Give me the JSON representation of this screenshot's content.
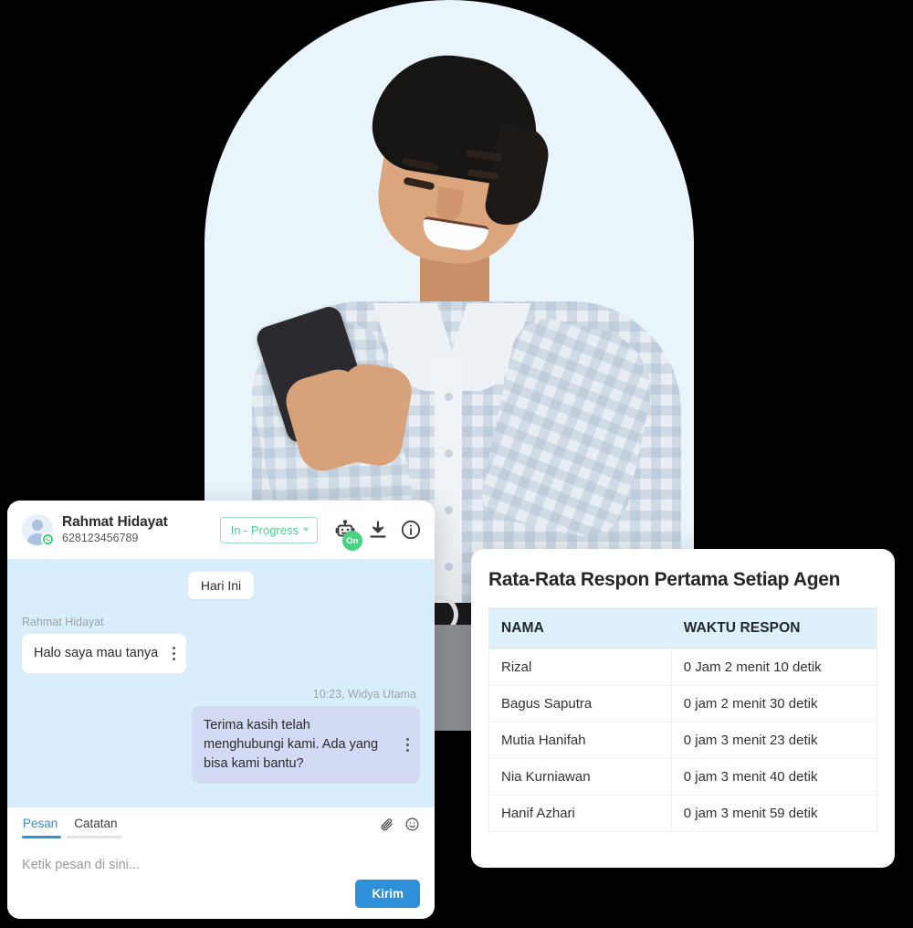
{
  "hero": {
    "alt": "smiling-young-man-using-smartphone",
    "arch_background_color": "#e9f4fb"
  },
  "chat": {
    "header": {
      "contact_name": "Rahmat Hidayat",
      "contact_phone": "628123456789",
      "status_label": "In - Progress",
      "bot_badge_label": "On",
      "icons": [
        "robot-icon",
        "download-icon",
        "info-icon"
      ],
      "accent_color": "#4fcf92"
    },
    "date_divider": "Hari Ini",
    "messages": [
      {
        "direction": "in",
        "meta": "Rahmat Hidayat",
        "text": "Halo saya mau tanya"
      },
      {
        "direction": "out",
        "meta": "10:23, Widya Utama",
        "text": "Terima kasih telah menghubungi kami. Ada yang bisa kami bantu?"
      }
    ],
    "composer": {
      "tabs": [
        {
          "label": "Pesan",
          "active": true
        },
        {
          "label": "Catatan",
          "active": false
        }
      ],
      "placeholder": "Ketik pesan di sini...",
      "send_label": "Kirim",
      "attach_icon": "paperclip-icon",
      "emoji_icon": "smiley-icon",
      "accent_color": "#2e90d8"
    }
  },
  "report": {
    "title": "Rata-Rata Respon Pertama Setiap Agen",
    "columns": [
      "NAMA",
      "WAKTU RESPON"
    ],
    "header_background": "#def0fa",
    "rows": [
      {
        "nama": "Rizal",
        "waktu": "0 Jam 2 menit 10 detik"
      },
      {
        "nama": "Bagus Saputra",
        "waktu": "0 jam 2 menit 30 detik"
      },
      {
        "nama": "Mutia Hanifah",
        "waktu": "0 jam 3 menit 23 detik"
      },
      {
        "nama": "Nia Kurniawan",
        "waktu": "0 jam 3 menit 40 detik"
      },
      {
        "nama": "Hanif Azhari",
        "waktu": "0 jam 3 menit 59 detik"
      }
    ]
  }
}
